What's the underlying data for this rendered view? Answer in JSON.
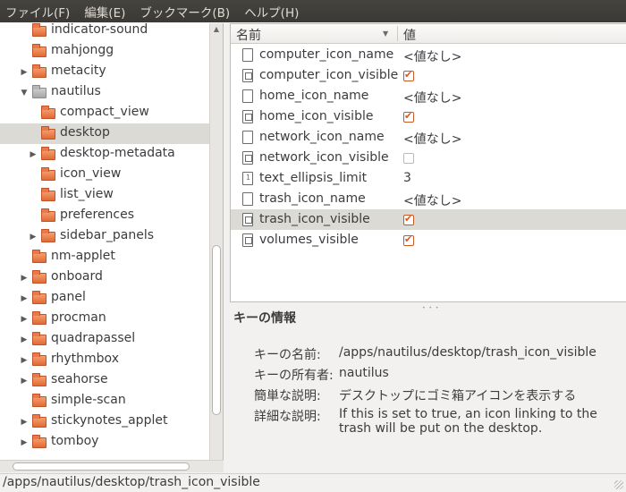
{
  "menubar": {
    "items": [
      "ファイル(F)",
      "編集(E)",
      "ブックマーク(B)",
      "ヘルプ(H)"
    ]
  },
  "tree": {
    "items": [
      {
        "label": "indicator-sound",
        "level": 1,
        "expander": "",
        "open": false,
        "selected": false
      },
      {
        "label": "mahjongg",
        "level": 1,
        "expander": "",
        "open": false,
        "selected": false
      },
      {
        "label": "metacity",
        "level": 1,
        "expander": "collapsed",
        "open": false,
        "selected": false
      },
      {
        "label": "nautilus",
        "level": 1,
        "expander": "expanded",
        "open": true,
        "selected": false
      },
      {
        "label": "compact_view",
        "level": 2,
        "expander": "",
        "open": false,
        "selected": false
      },
      {
        "label": "desktop",
        "level": 2,
        "expander": "",
        "open": false,
        "selected": true
      },
      {
        "label": "desktop-metadata",
        "level": 2,
        "expander": "collapsed",
        "open": false,
        "selected": false
      },
      {
        "label": "icon_view",
        "level": 2,
        "expander": "",
        "open": false,
        "selected": false
      },
      {
        "label": "list_view",
        "level": 2,
        "expander": "",
        "open": false,
        "selected": false
      },
      {
        "label": "preferences",
        "level": 2,
        "expander": "",
        "open": false,
        "selected": false
      },
      {
        "label": "sidebar_panels",
        "level": 2,
        "expander": "collapsed",
        "open": false,
        "selected": false
      },
      {
        "label": "nm-applet",
        "level": 1,
        "expander": "",
        "open": false,
        "selected": false
      },
      {
        "label": "onboard",
        "level": 1,
        "expander": "collapsed",
        "open": false,
        "selected": false
      },
      {
        "label": "panel",
        "level": 1,
        "expander": "collapsed",
        "open": false,
        "selected": false
      },
      {
        "label": "procman",
        "level": 1,
        "expander": "collapsed",
        "open": false,
        "selected": false
      },
      {
        "label": "quadrapassel",
        "level": 1,
        "expander": "collapsed",
        "open": false,
        "selected": false
      },
      {
        "label": "rhythmbox",
        "level": 1,
        "expander": "collapsed",
        "open": false,
        "selected": false
      },
      {
        "label": "seahorse",
        "level": 1,
        "expander": "collapsed",
        "open": false,
        "selected": false
      },
      {
        "label": "simple-scan",
        "level": 1,
        "expander": "",
        "open": false,
        "selected": false
      },
      {
        "label": "stickynotes_applet",
        "level": 1,
        "expander": "collapsed",
        "open": false,
        "selected": false
      },
      {
        "label": "tomboy",
        "level": 1,
        "expander": "collapsed",
        "open": false,
        "selected": false
      }
    ]
  },
  "key_list": {
    "header_name": "名前",
    "header_value": "値",
    "rows": [
      {
        "name": "computer_icon_name",
        "type": "string",
        "value": "<値なし>",
        "selected": false
      },
      {
        "name": "computer_icon_visible",
        "type": "bool",
        "checked": true,
        "selected": false
      },
      {
        "name": "home_icon_name",
        "type": "string",
        "value": "<値なし>",
        "selected": false
      },
      {
        "name": "home_icon_visible",
        "type": "bool",
        "checked": true,
        "selected": false
      },
      {
        "name": "network_icon_name",
        "type": "string",
        "value": "<値なし>",
        "selected": false
      },
      {
        "name": "network_icon_visible",
        "type": "bool",
        "checked": false,
        "selected": false
      },
      {
        "name": "text_ellipsis_limit",
        "type": "int",
        "value": "3",
        "selected": false
      },
      {
        "name": "trash_icon_name",
        "type": "string",
        "value": "<値なし>",
        "selected": false
      },
      {
        "name": "trash_icon_visible",
        "type": "bool",
        "checked": true,
        "selected": true
      },
      {
        "name": "volumes_visible",
        "type": "bool",
        "checked": true,
        "selected": false
      }
    ]
  },
  "key_info": {
    "title": "キーの情報",
    "name_label": "キーの名前:",
    "name_value": "/apps/nautilus/desktop/trash_icon_visible",
    "owner_label": "キーの所有者:",
    "owner_value": "nautilus",
    "short_label": "簡単な説明:",
    "short_value": "デスクトップにゴミ箱アイコンを表示する",
    "long_label": "詳細な説明:",
    "long_value": "If this is set to true, an icon linking to the trash will be put on the desktop."
  },
  "statusbar": {
    "path": "/apps/nautilus/desktop/trash_icon_visible"
  },
  "colors": {
    "menubar": "#3c3b37",
    "selection": "#dcdad5",
    "folder": "#e8794a",
    "check": "#e0561c"
  }
}
